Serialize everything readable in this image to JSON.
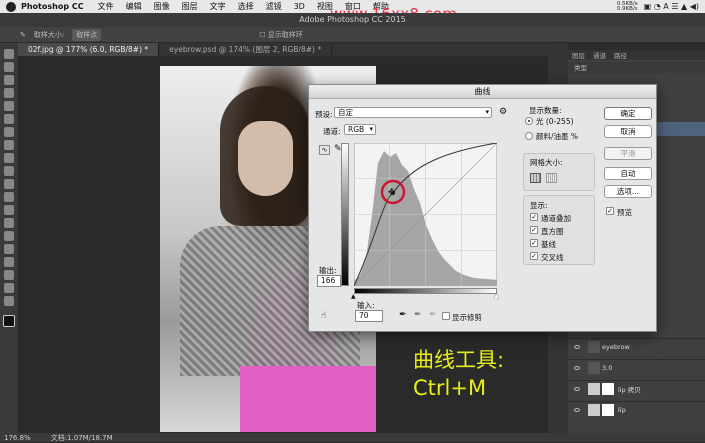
{
  "menubar": {
    "app_name": "Photoshop CC",
    "items": [
      "文件",
      "编辑",
      "图像",
      "图层",
      "文字",
      "选择",
      "滤镜",
      "3D",
      "视图",
      "窗口",
      "帮助"
    ],
    "net_up": "0.5KB/s",
    "net_down": "0.9KB/s"
  },
  "watermark": "www.16xx8.com",
  "window_title": "Adobe Photoshop CC 2015",
  "options": {
    "sample_size_label": "取样大小:",
    "sample_size_value": "取样点",
    "show_ring": "显示取样环"
  },
  "tabs": [
    {
      "label": "02f.jpg @ 177% (6.0, RGB/8#) *"
    },
    {
      "label": "eyebrow.psd @ 174% (图层 2, RGB/8#) *"
    }
  ],
  "layers_panel": {
    "tabs": [
      "图层",
      "通道",
      "路径"
    ],
    "filter_label": "类型",
    "layers": [
      {
        "name": "eyebrow"
      },
      {
        "name": "3.0"
      },
      {
        "name": "lip 拷贝"
      },
      {
        "name": "lip"
      }
    ]
  },
  "status": {
    "zoom": "176.8%",
    "doc": "文档:1.07M/18.7M"
  },
  "caption": {
    "line1": "曲线工具:",
    "line2": "Ctrl+M"
  },
  "curves": {
    "title": "曲线",
    "preset_label": "预设:",
    "preset_value": "自定",
    "channel_label": "通道:",
    "channel_value": "RGB",
    "output_label": "输出:",
    "output_value": "166",
    "input_label": "输入:",
    "input_value": "70",
    "show_clipping": "显示修剪",
    "display_amount_label": "显示数量:",
    "light_option": "光 (0-255)",
    "pigment_option": "颜料/油墨 %",
    "grid_size_label": "网格大小:",
    "show_label": "显示:",
    "show_options": [
      "通道叠加",
      "直方图",
      "基线",
      "交叉线"
    ],
    "buttons": {
      "ok": "确定",
      "cancel": "取消",
      "smooth": "平滑",
      "auto": "自动",
      "options": "选项...",
      "preview": "预览"
    },
    "accent_ring_color": "#c8192e"
  }
}
